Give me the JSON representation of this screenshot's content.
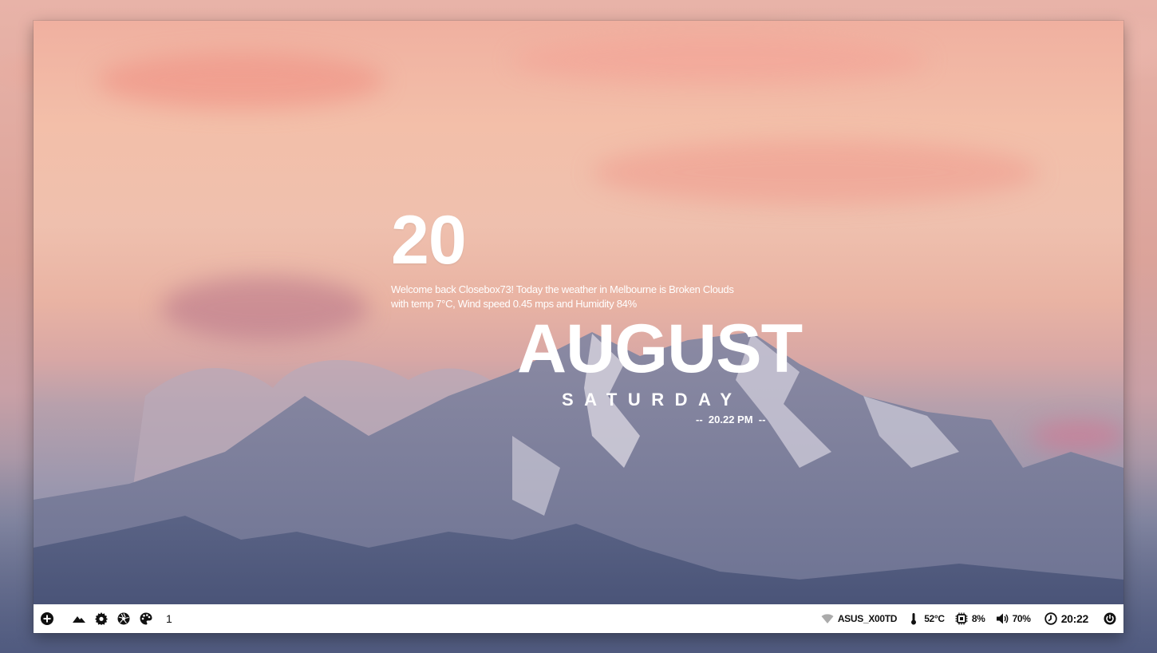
{
  "widget": {
    "day": "20",
    "welcome_line1": "Welcome back Closebox73! Today the weather in Melbourne is Broken Clouds",
    "welcome_line2": "with temp 7°C, Wind speed 0.45 mps and Humidity 84%",
    "month": "AUGUST",
    "weekday": "SATURDAY",
    "time_prefix": "--",
    "time": "20.22 PM",
    "time_suffix": "--"
  },
  "taskbar": {
    "left": {
      "launcher_icon": "plus-circle-icon",
      "icons": [
        "mountain-icon",
        "gear-icon",
        "aperture-icon",
        "palette-icon"
      ],
      "workspace": "1"
    },
    "right": {
      "wifi_icon": "wifi-icon",
      "network_name": "ASUS_X00TD",
      "temp_icon": "thermometer-icon",
      "temperature": "52°C",
      "cpu_icon": "cpu-icon",
      "cpu": "8%",
      "volume_icon": "volume-icon",
      "volume": "70%",
      "clock_icon": "clock-icon",
      "clock": "20:22",
      "power_icon": "power-icon"
    }
  },
  "colors": {
    "taskbar_bg": "#ffffff",
    "widget_text": "#ffffff",
    "taskbar_text": "#111111"
  }
}
